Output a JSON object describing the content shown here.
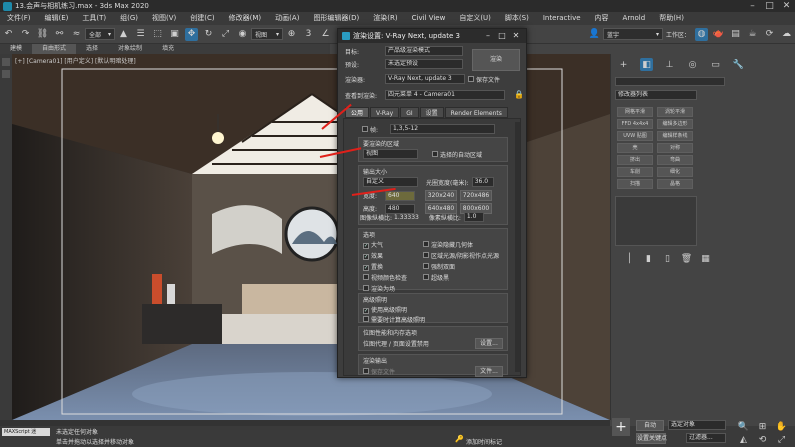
{
  "window": {
    "title": "13.会声与相机练习.max - 3ds Max 2020"
  },
  "menu": [
    "文件(F)",
    "编辑(E)",
    "工具(T)",
    "组(G)",
    "视图(V)",
    "创建(C)",
    "修改器(M)",
    "动画(A)",
    "图形编辑器(D)",
    "渲染(R)",
    "Civil View",
    "自定义(U)",
    "脚本(S)",
    "Interactive",
    "内容",
    "Arnold",
    "帮助(H)"
  ],
  "toolbar": {
    "selection_filter": "全部",
    "view_dropdown": "视图",
    "user_label": "蓝宇",
    "workspace_label": "工作区："
  },
  "ribbon": {
    "tabs": [
      "建模",
      "自由形式",
      "选择",
      "对象绘制",
      "填充"
    ]
  },
  "viewport": {
    "label": "[+] [Camera01] [用户定义] [默认明暗处理]"
  },
  "render_dialog": {
    "title": "渲染设置: V-Ray Next, update 3",
    "target_label": "目标:",
    "target_value": "产品级渲染模式",
    "preset_label": "预设:",
    "preset_value": "未选定预设",
    "renderer_label": "渲染器:",
    "renderer_value": "V-Ray Next, update 3",
    "save_file_label": "保存文件",
    "view_label": "查看到渲染:",
    "view_value": "四元菜单 4 - Camera01",
    "render_button": "渲染",
    "tabs": [
      "公用",
      "V-Ray",
      "GI",
      "设置",
      "Render Elements"
    ],
    "frames_label": "帧:",
    "frames_value": "1,3,5-12",
    "area_section_title": "要渲染的区域",
    "area_value": "视图",
    "auto_region_label": "选择的自动区域",
    "output_size_title": "输出大小",
    "output_size_value": "自定义",
    "aperture_label": "光圈宽度(毫米):",
    "aperture_value": "36.0",
    "width_label": "宽度:",
    "width_value": "640",
    "height_label": "高度:",
    "height_value": "480",
    "presets": [
      "320x240",
      "720x486",
      "640x480",
      "800x600"
    ],
    "aspect_label": "图像纵横比:",
    "aspect_value": "1.33333",
    "pixel_aspect_label": "像素纵横比:",
    "pixel_aspect_value": "1.0",
    "options_title": "选项",
    "options": [
      {
        "label": "大气",
        "checked": true
      },
      {
        "label": "渲染隐藏几何体",
        "checked": false
      },
      {
        "label": "效果",
        "checked": true
      },
      {
        "label": "区域光源/阴影视作点光源",
        "checked": false
      },
      {
        "label": "置换",
        "checked": true
      },
      {
        "label": "强制双面",
        "checked": false
      },
      {
        "label": "视频颜色检查",
        "checked": false
      },
      {
        "label": "超级黑",
        "checked": false
      },
      {
        "label": "渲染为场",
        "checked": false
      }
    ],
    "adv_lighting_title": "高级照明",
    "adv_lighting_use": "使用高级照明",
    "adv_lighting_compute": "需要时计算高级照明",
    "bitmap_title": "位图性能和内存选项",
    "bitmap_text": "位图代理 / 页面设置禁用",
    "setup_button": "设置...",
    "render_output_title": "渲染输出",
    "save_file_checkbox": "保存文件",
    "files_button": "文件..."
  },
  "command_panel": {
    "modifier_list": "修改器列表",
    "buttons": [
      "网格平滑",
      "涡轮平滑",
      "FFD 4x4x4",
      "编辑多边形",
      "UVW 贴图",
      "编辑样条线",
      "壳",
      "对称",
      "挤出",
      "弯曲",
      "车削",
      "细化",
      "扫描",
      "晶格",
      "晶格"
    ]
  },
  "status": {
    "maxscript": "MAXScript 迷",
    "line1": "未选定任何对象",
    "line2": "单击并拖动以选择并移动对象",
    "add_time_tag": "添加时间标记",
    "auto_key": "自动",
    "set_key": "设置关键点",
    "selected": "选定对象",
    "filters": "过滤器..."
  },
  "colors": {
    "accent": "#2f6f9e",
    "arrow": "#e0201a"
  }
}
